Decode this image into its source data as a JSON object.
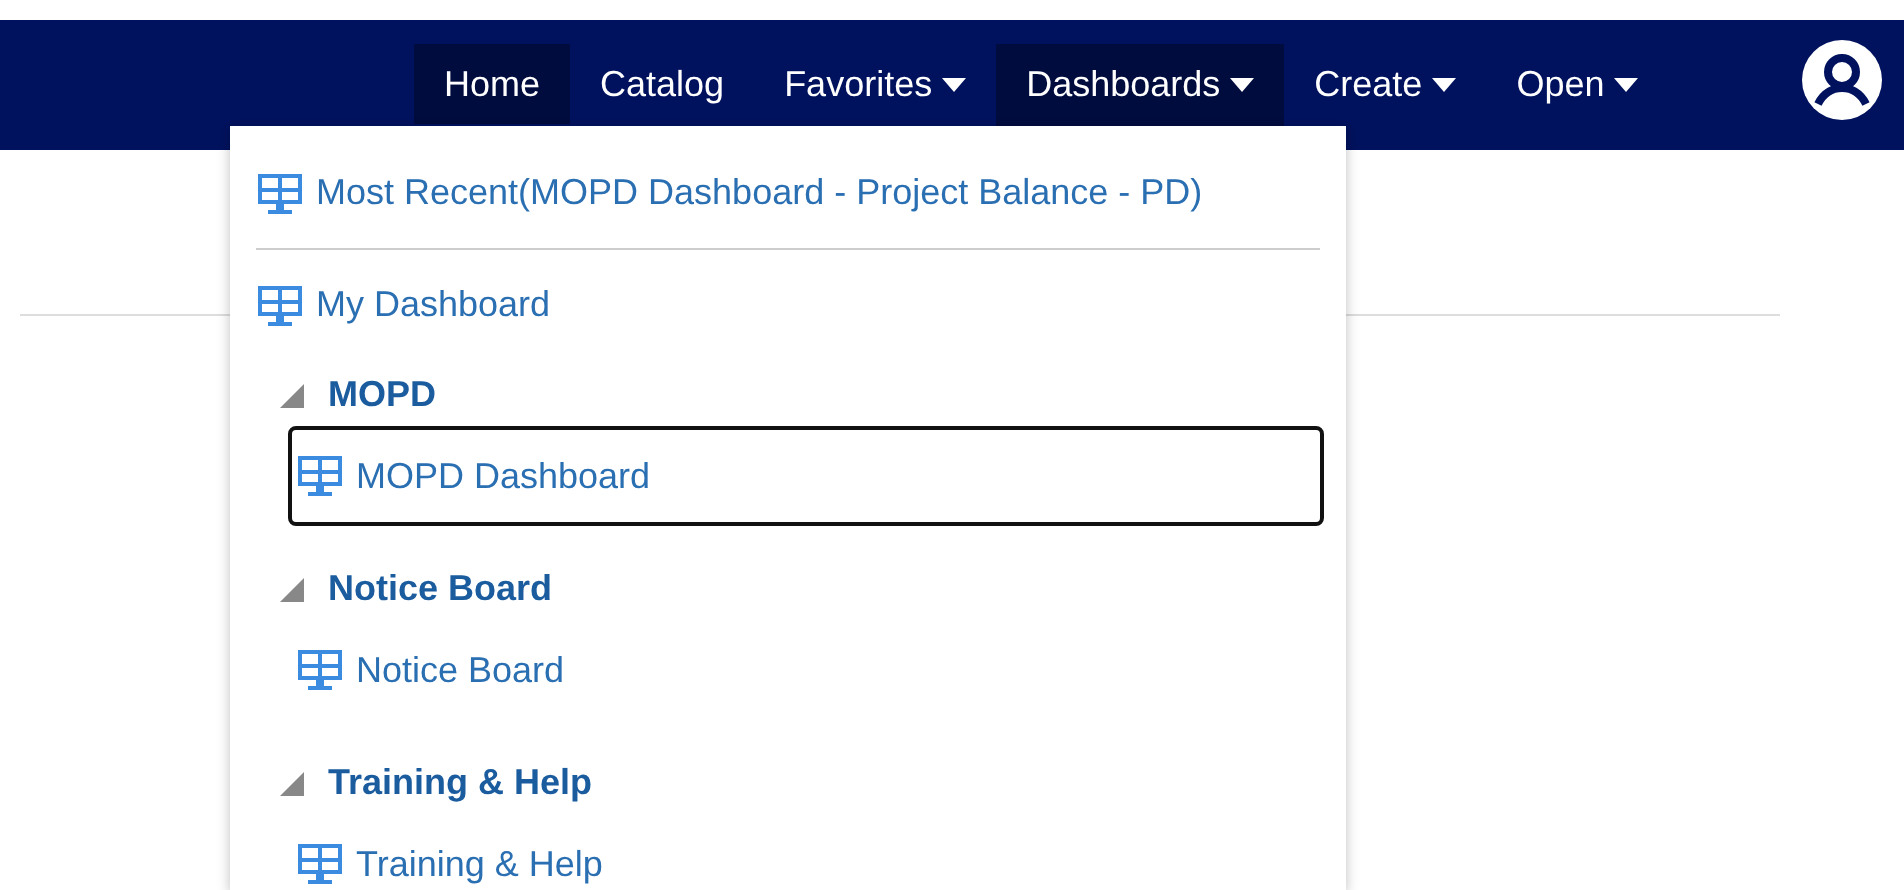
{
  "navbar": {
    "items": [
      {
        "label": "Home",
        "kind": "link",
        "selected": true
      },
      {
        "label": "Catalog",
        "kind": "link",
        "selected": false
      },
      {
        "label": "Favorites",
        "kind": "menu",
        "expanded": false
      },
      {
        "label": "Dashboards",
        "kind": "menu",
        "expanded": true
      },
      {
        "label": "Create",
        "kind": "menu",
        "expanded": false
      },
      {
        "label": "Open",
        "kind": "menu",
        "expanded": false
      }
    ]
  },
  "dashboards_menu": {
    "most_recent": "Most Recent(MOPD Dashboard - Project Balance - PD)",
    "my_dashboard": "My Dashboard",
    "groups": [
      {
        "title": "MOPD",
        "expanded": true,
        "children": [
          {
            "label": "MOPD Dashboard",
            "focused": true
          }
        ]
      },
      {
        "title": "Notice Board",
        "expanded": true,
        "children": [
          {
            "label": "Notice Board",
            "focused": false
          }
        ]
      },
      {
        "title": "Training & Help",
        "expanded": true,
        "children": [
          {
            "label": "Training & Help",
            "focused": false
          }
        ]
      }
    ]
  }
}
